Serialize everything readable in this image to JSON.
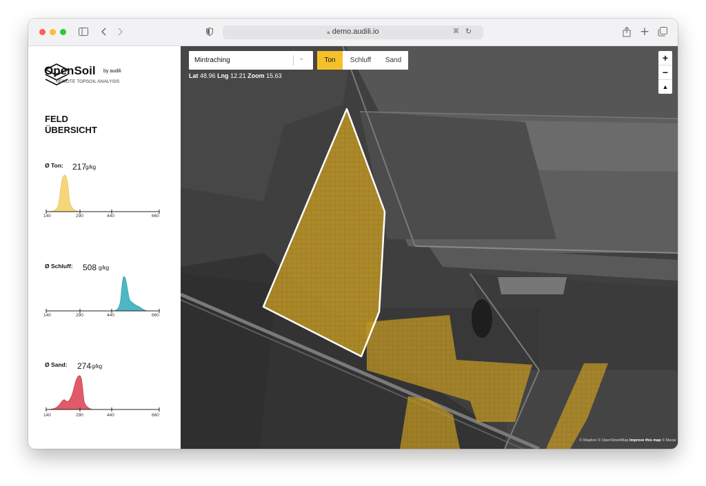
{
  "browser": {
    "url": "demo.audili.io"
  },
  "brand": {
    "name": "OpenSoil",
    "by": "by audili",
    "tagline": "REMOTE TOPSOIL ANALYSIS"
  },
  "sidebar": {
    "heading": "FELD\nÜBERSICHT",
    "stats": [
      {
        "label": "Ø Ton:",
        "value": "217",
        "unit": "g/kg",
        "color": "#f5d77a"
      },
      {
        "label": "Ø Schluff:",
        "value": "508",
        "unit": "g/kg",
        "color": "#4db8c4"
      },
      {
        "label": "Ø Sand:",
        "value": "274",
        "unit": "g/kg",
        "color": "#e05a6a"
      }
    ],
    "axis_ticks": [
      "140",
      "290",
      "440",
      "660"
    ]
  },
  "map": {
    "field_select": "Mintraching",
    "layers": [
      "Ton",
      "Schluff",
      "Sand"
    ],
    "active_layer": "Ton",
    "active_color": "#f5c12b",
    "coords": {
      "lat_label": "Lat",
      "lat": "48.96",
      "lng_label": "Lng",
      "lng": "12.21",
      "zoom_label": "Zoom",
      "zoom": "15.63"
    },
    "controls": {
      "zoom_in": "+",
      "zoom_out": "−",
      "compass": "▲"
    },
    "attribution": {
      "mapbox": "© Mapbox",
      "osm": "© OpenStreetMap",
      "improve": "Improve this map",
      "maxar": "© Maxar"
    },
    "overlay_color": "#c49a24"
  }
}
